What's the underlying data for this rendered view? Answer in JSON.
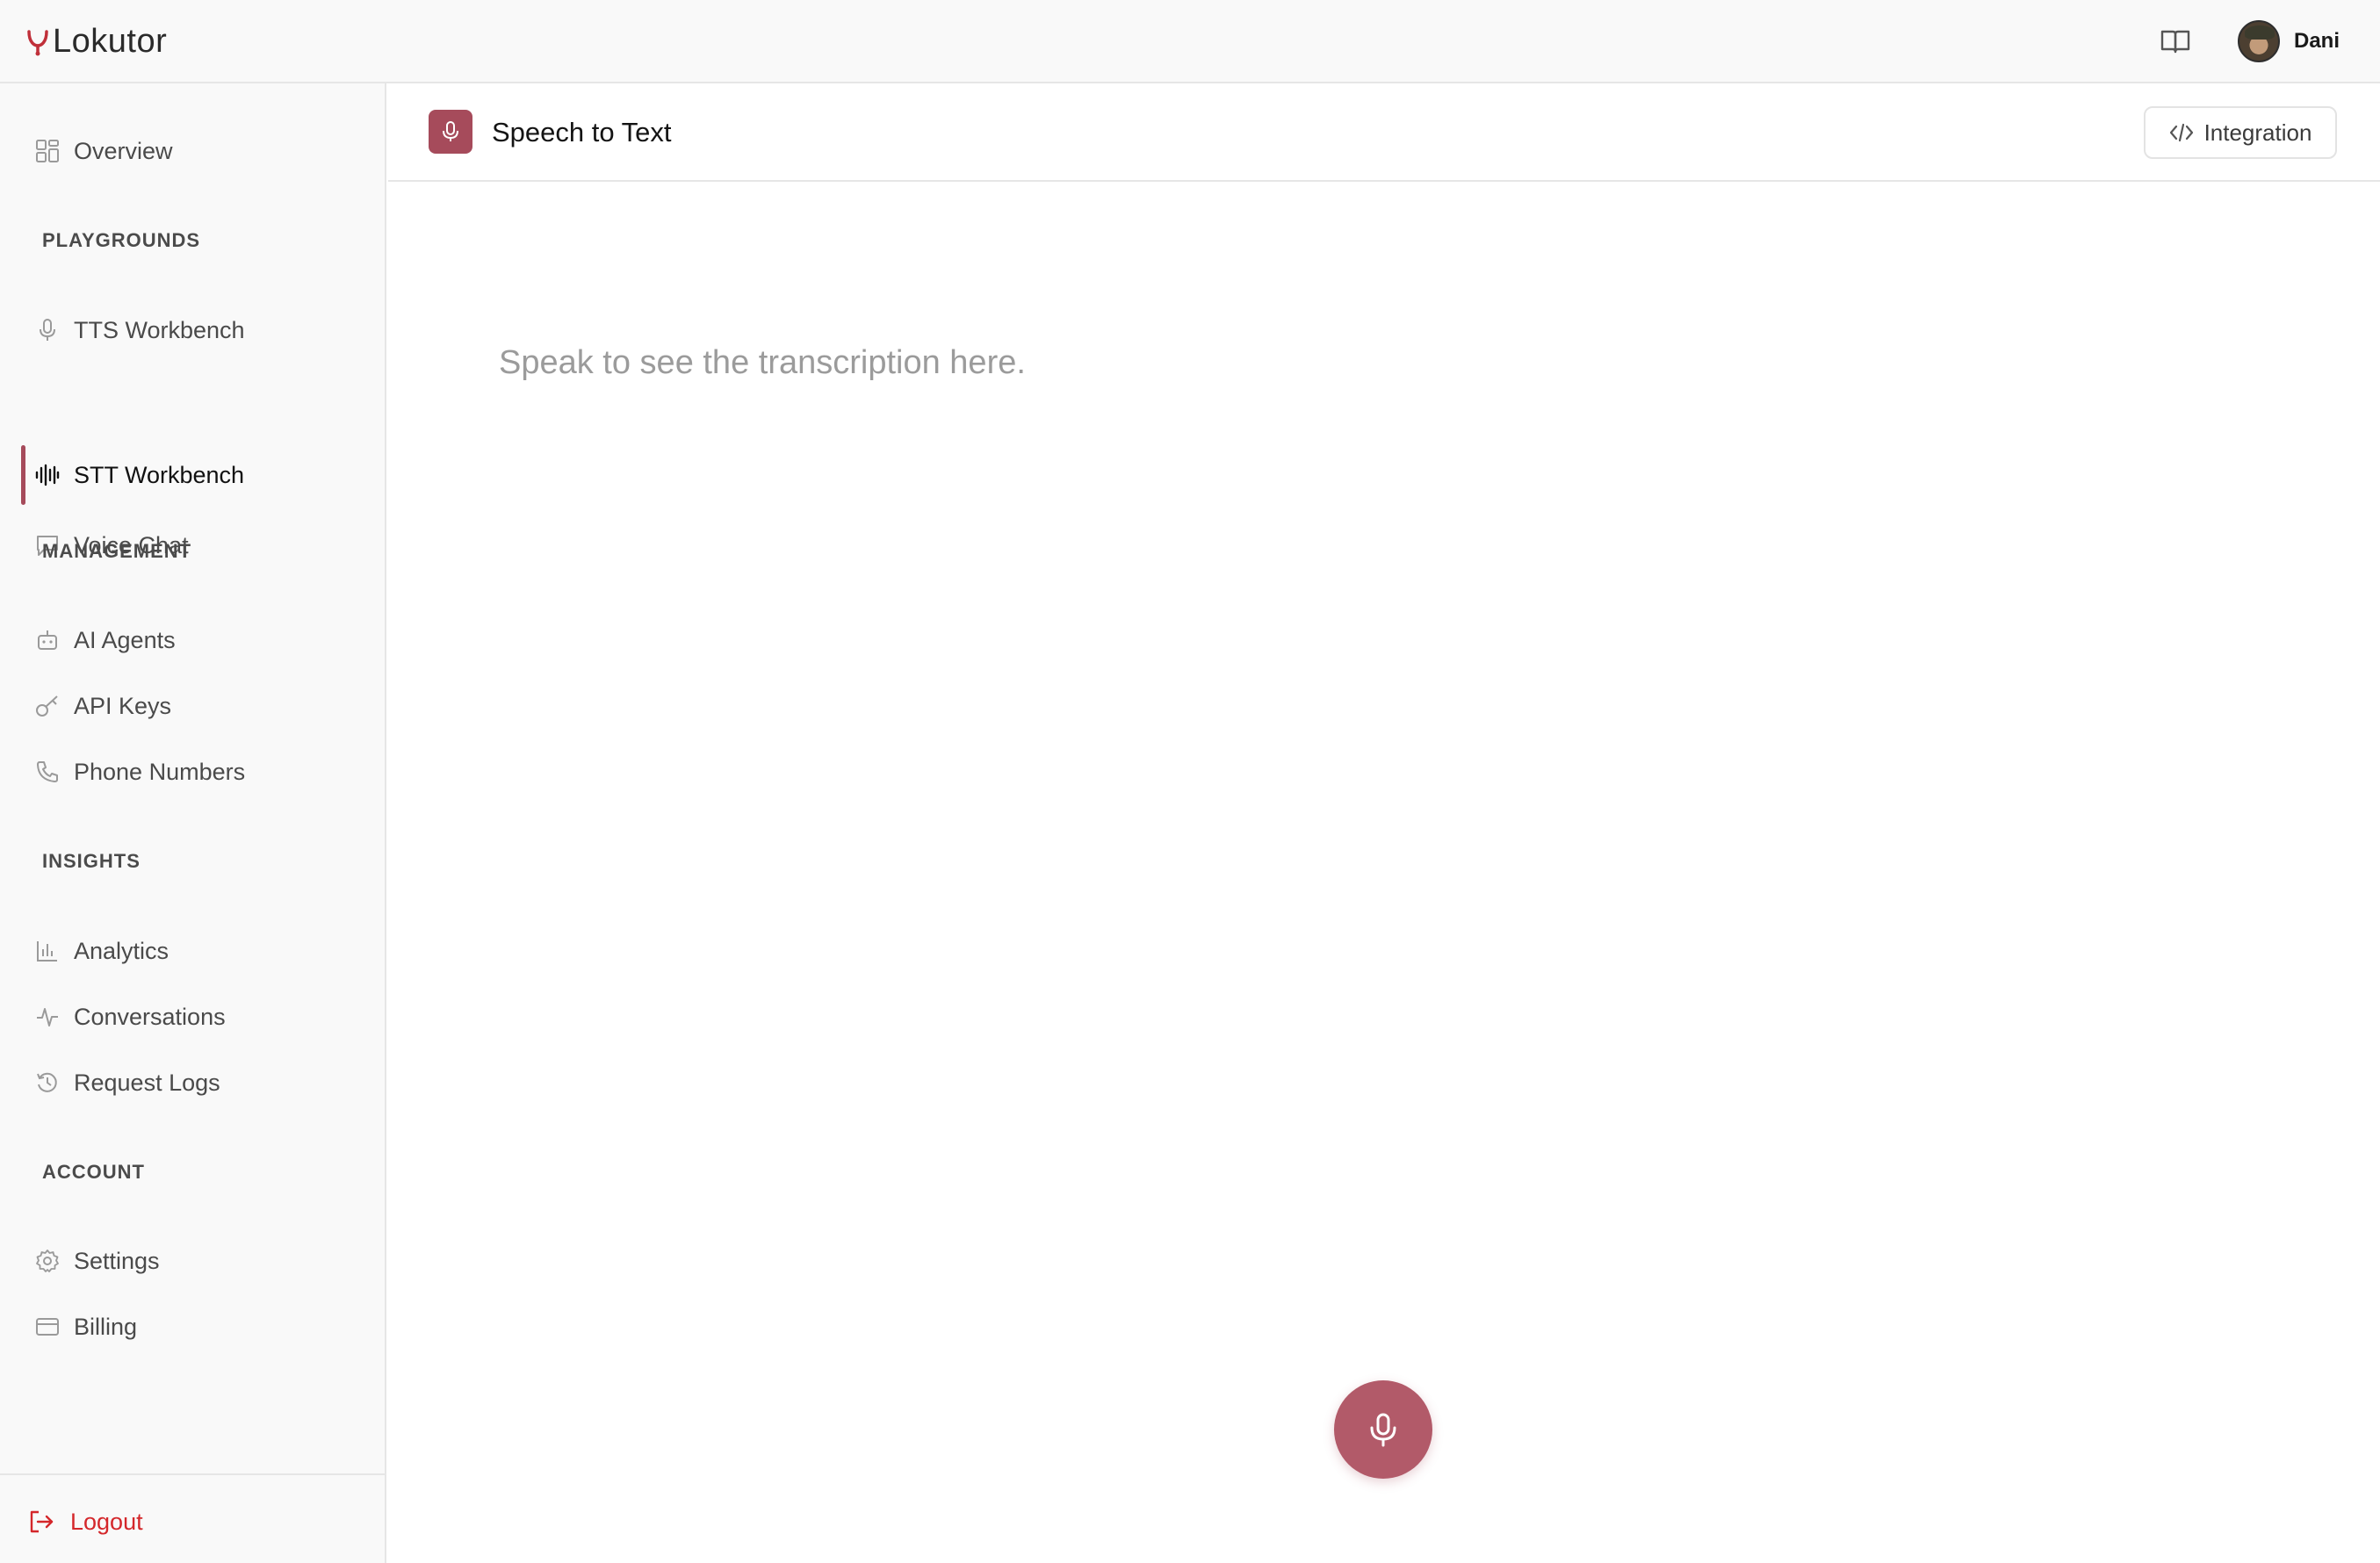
{
  "app": {
    "brand_name": "Lokutor",
    "accent_color": "#a64b5b",
    "docs_icon": "book-open-icon"
  },
  "user": {
    "name": "Dani",
    "avatar_icon": "user-avatar"
  },
  "sidebar": {
    "overview": {
      "label": "Overview",
      "icon": "grid-icon"
    },
    "sections": {
      "playgrounds": "PLAYGROUNDS",
      "management": "MANAGEMENT",
      "insights": "INSIGHTS",
      "account": "ACCOUNT"
    },
    "items": {
      "tts": {
        "label": "TTS Workbench",
        "icon": "microphone-icon"
      },
      "stt": {
        "label": "STT Workbench",
        "icon": "audio-wave-icon",
        "active": true
      },
      "voice_chat": {
        "label": "Voice Chat",
        "icon": "chat-bubble-icon"
      },
      "ai_agents": {
        "label": "AI Agents",
        "icon": "robot-icon"
      },
      "api_keys": {
        "label": "API Keys",
        "icon": "key-icon"
      },
      "phone_numbers": {
        "label": "Phone Numbers",
        "icon": "phone-icon"
      },
      "analytics": {
        "label": "Analytics",
        "icon": "bar-chart-icon"
      },
      "conversations": {
        "label": "Conversations",
        "icon": "activity-icon"
      },
      "request_logs": {
        "label": "Request Logs",
        "icon": "history-icon"
      },
      "settings": {
        "label": "Settings",
        "icon": "gear-icon"
      },
      "billing": {
        "label": "Billing",
        "icon": "credit-card-icon"
      }
    },
    "logout": {
      "label": "Logout",
      "icon": "logout-icon",
      "color": "#d4272b"
    }
  },
  "page": {
    "title": "Speech to Text",
    "title_icon": "microphone-icon",
    "integration_label": "Integration",
    "integration_icon": "code-icon",
    "transcript_placeholder": "Speak to see the transcription here.",
    "record_button_icon": "microphone-icon"
  }
}
